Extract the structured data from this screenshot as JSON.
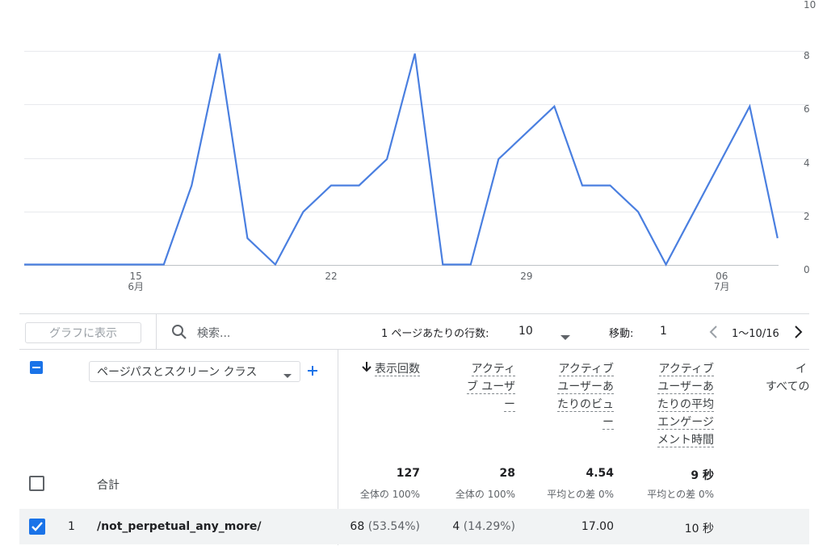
{
  "chart_data": {
    "type": "line",
    "x": [
      "6/11",
      "6/12",
      "6/13",
      "6/14",
      "6/15",
      "6/16",
      "6/17",
      "6/18",
      "6/19",
      "6/20",
      "6/21",
      "6/22",
      "6/23",
      "6/24",
      "6/25",
      "6/26",
      "6/27",
      "6/28",
      "6/29",
      "6/30",
      "7/1",
      "7/2",
      "7/3",
      "7/4",
      "7/5",
      "7/6",
      "7/7",
      "7/8",
      "7/9",
      "7/10",
      "7/11"
    ],
    "values": [
      0,
      0,
      0,
      0,
      0,
      0,
      3,
      8,
      1,
      0,
      2,
      3,
      3,
      4,
      8,
      0,
      0,
      4,
      5,
      6,
      3,
      3,
      2,
      0,
      2,
      4,
      6,
      1
    ],
    "x_tick_labels": [
      {
        "text": "15",
        "sub": "6月",
        "index": 4
      },
      {
        "text": "22",
        "sub": "",
        "index": 11
      },
      {
        "text": "29",
        "sub": "",
        "index": 18
      },
      {
        "text": "06",
        "sub": "7月",
        "index": 25
      }
    ],
    "y_ticks": [
      "0",
      "2",
      "4",
      "6",
      "8",
      "10"
    ],
    "ylim": [
      0,
      10
    ],
    "color": "#4a7fe0",
    "grid": true
  },
  "toolbar": {
    "graph_button": "グラフに表示",
    "search_placeholder": "検索...",
    "rows_per_page_label": "1 ページあたりの行数:",
    "rows_per_page_value": "10",
    "goto_label": "移動:",
    "goto_value": "1",
    "page_range": "1〜10/16"
  },
  "table": {
    "dimension_label": "ページパスとスクリーン クラス",
    "headers": {
      "views": "表示回数",
      "active_users": [
        "アクティ",
        "ブ ユーザ",
        "ー"
      ],
      "views_per_user": [
        "アクティブ",
        "ユーザーあ",
        "たりのビュ",
        "ー"
      ],
      "avg_engagement": [
        "アクティブ",
        "ユーザーあ",
        "たりの平均",
        "エンゲージ",
        "メント時間"
      ],
      "cut_off": [
        "イ",
        "すべての"
      ]
    },
    "total": {
      "label": "合計",
      "views": "127",
      "views_sub": "全体の 100%",
      "active_users": "28",
      "active_users_sub": "全体の 100%",
      "views_per_user": "4.54",
      "views_per_user_sub": "平均との差 0%",
      "avg_engagement": "9 秒",
      "avg_engagement_sub": "平均との差 0%"
    },
    "rows": [
      {
        "index": "1",
        "path": "/not_perpetual_any_more/",
        "views": "68",
        "views_pct": "(53.54%)",
        "active_users": "4",
        "active_users_pct": "(14.29%)",
        "views_per_user": "17.00",
        "avg_engagement": "10 秒"
      }
    ]
  },
  "colors": {
    "accent": "#4a7fe0",
    "checkbox": "#1a73e8"
  }
}
